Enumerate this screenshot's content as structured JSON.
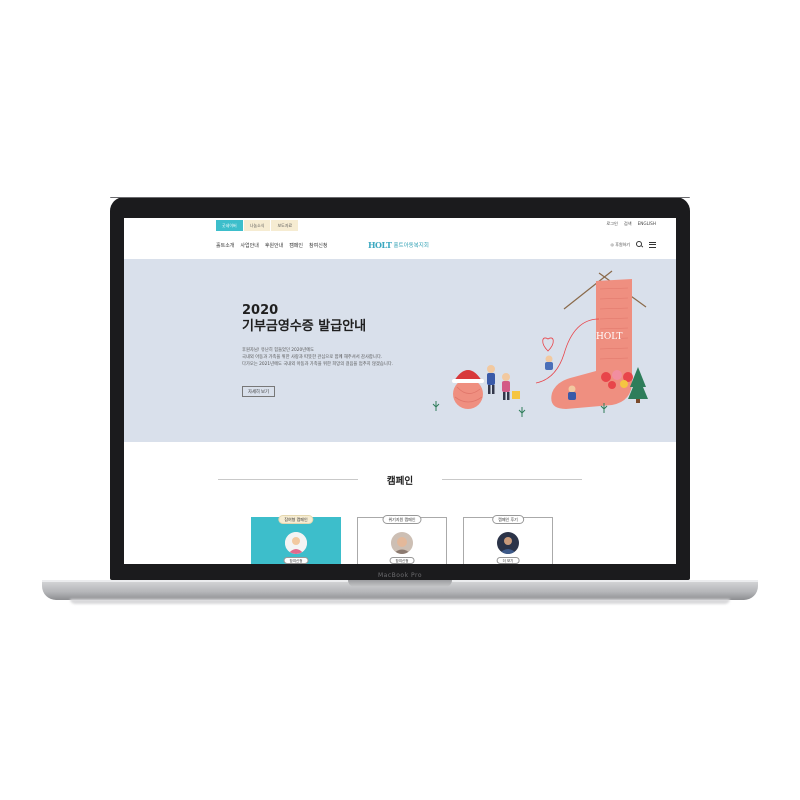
{
  "device": {
    "label": "MacBook Pro"
  },
  "topbar": {
    "tabs": [
      {
        "label": "굿네이버"
      },
      {
        "label": "나눔소식"
      },
      {
        "label": "보도자료"
      }
    ],
    "util": [
      {
        "label": "로그인"
      },
      {
        "label": "검색"
      },
      {
        "label": "ENGLISH"
      }
    ]
  },
  "nav": {
    "menu": [
      {
        "label": "홀트소개"
      },
      {
        "label": "사업안내"
      },
      {
        "label": "후원안내"
      },
      {
        "label": "캠페인"
      },
      {
        "label": "참여신청"
      }
    ],
    "logo_mark": "HOLT",
    "logo_text": "홀트아동복지회",
    "donate_label": "후원하기",
    "search_icon": "search-icon",
    "menu_icon": "hamburger-menu-icon"
  },
  "hero": {
    "title_line1": "2020",
    "title_line2": "기부금영수증 발급안내",
    "desc_line1": "후원자님! 유난히 힘들었던 2020년에도",
    "desc_line2": "국내외 아동과 가족을 위한 사랑과 따뜻한 관심으로 함께 해주셔서 감사합니다.",
    "desc_line3": "다가오는 2021년에도 국내외 아동과 가족을 위한 희망의 걸음을 멈추지 않겠습니다.",
    "button_label": "자세히 보기",
    "colors": {
      "background": "#d9e0eb",
      "sock": "#ef8f80",
      "heart": "#e8454a",
      "tree": "#2e7d5a"
    }
  },
  "campaign": {
    "title": "캠페인",
    "cards": [
      {
        "label": "참여형 캠페인",
        "chip": "참여신청",
        "style": "teal"
      },
      {
        "label": "위기지원 캠페인",
        "chip": "참여신청",
        "style": "white"
      },
      {
        "label": "캠페인 후기",
        "chip": "더 보기",
        "style": "white"
      }
    ]
  },
  "colors": {
    "accent": "#3dbecb",
    "tab_bg": "#f6ecd2"
  }
}
